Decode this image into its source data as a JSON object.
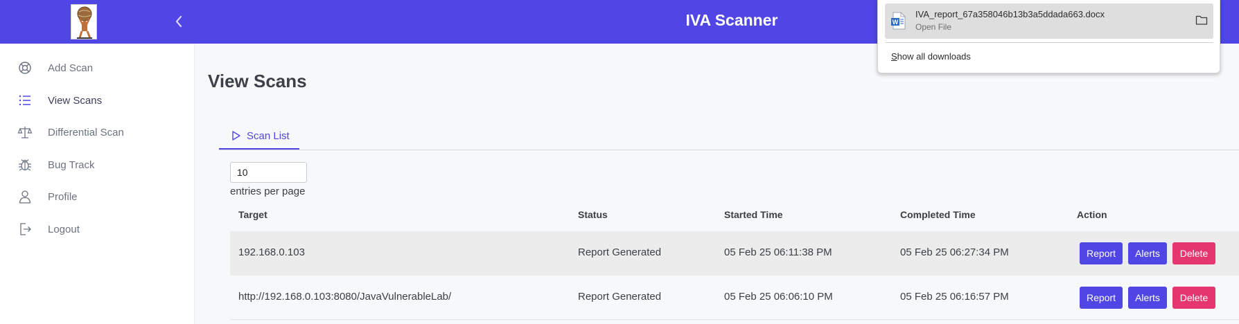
{
  "header": {
    "title": "IVA Scanner",
    "logo_icon": "atlas-logo-icon",
    "collapse_icon": "chevron-left-icon",
    "color": "#4f46e5"
  },
  "sidebar": {
    "items": [
      {
        "label": "Add Scan",
        "icon": "lifebuoy-icon"
      },
      {
        "label": "View Scans",
        "icon": "list-icon",
        "active": true
      },
      {
        "label": "Differential Scan",
        "icon": "scale-icon"
      },
      {
        "label": "Bug Track",
        "icon": "bug-icon"
      },
      {
        "label": "Profile",
        "icon": "user-icon"
      },
      {
        "label": "Logout",
        "icon": "logout-icon"
      }
    ]
  },
  "main": {
    "title": "View Scans",
    "tab": {
      "label": "Scan List",
      "icon": "play-outline-icon"
    },
    "entries": {
      "value": "10",
      "label": "entries per page"
    },
    "table": {
      "columns": [
        "Target",
        "Status",
        "Started Time",
        "Completed Time",
        "Action"
      ],
      "rows": [
        {
          "target": "192.168.0.103",
          "status": "Report Generated",
          "started": "05 Feb 25 06:11:38 PM",
          "completed": "05 Feb 25 06:27:34 PM"
        },
        {
          "target": "http://192.168.0.103:8080/JavaVulnerableLab/",
          "status": "Report Generated",
          "started": "05 Feb 25 06:06:10 PM",
          "completed": "05 Feb 25 06:16:57 PM"
        }
      ],
      "actions": {
        "report": "Report",
        "alerts": "Alerts",
        "delete": "Delete"
      }
    }
  },
  "downloads": {
    "file_name": "IVA_report_67a358046b13b3a5ddada663.docx",
    "file_sub": "Open File",
    "show_all": "Show all downloads",
    "file_icon": "word-doc-icon",
    "folder_icon": "folder-icon"
  },
  "colors": {
    "accent": "#4f46e5",
    "danger": "#e63670"
  }
}
